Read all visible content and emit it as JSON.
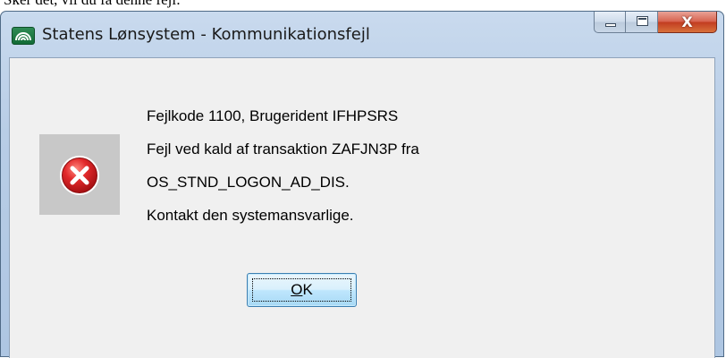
{
  "page": {
    "background_text": "Sker det, vil du få denne fejl:"
  },
  "window": {
    "title": "Statens Lønsystem - Kommunikationsfejl",
    "app_icon": "rainbow-logo-icon",
    "caption_buttons": {
      "minimize": "minimize-icon",
      "maximize": "maximize-icon",
      "close": "X"
    }
  },
  "dialog": {
    "icon": "error-icon",
    "message_lines": [
      "Fejlkode 1100, Brugerident IFHPSRS",
      "Fejl ved kald af transaktion ZAFJN3P fra",
      "OS_STND_LOGON_AD_DIS.",
      "Kontakt den systemansvarlige."
    ],
    "ok_button": {
      "accelerator": "O",
      "rest": "K"
    }
  },
  "colors": {
    "error_red": "#e2292b",
    "app_icon_green": "#1d7a43",
    "close_button_red": "#c23c21"
  }
}
